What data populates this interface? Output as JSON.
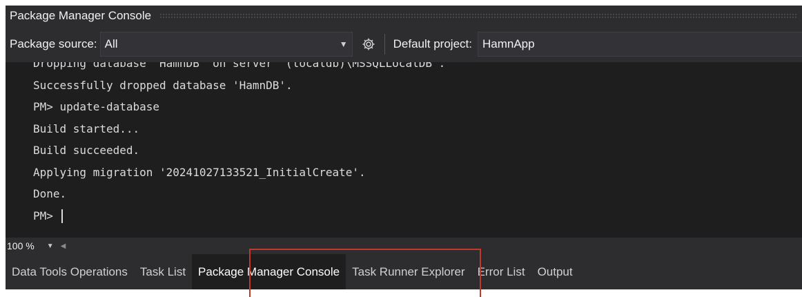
{
  "window": {
    "title": "Package Manager Console"
  },
  "toolbar": {
    "package_source_label": "Package source:",
    "package_source_value": "All",
    "default_project_label": "Default project:",
    "default_project_value": "HamnApp"
  },
  "console": {
    "lines": [
      "Dropping database 'HamnDB' on server '(localdb)\\MSSQLLocalDB'.",
      "Successfully dropped database 'HamnDB'.",
      "PM> update-database",
      "Build started...",
      "Build succeeded.",
      "Applying migration '20241027133521_InitialCreate'.",
      "Done.",
      "PM> "
    ]
  },
  "zoom": {
    "value": "100 %"
  },
  "tabs": [
    {
      "label": "Data Tools Operations"
    },
    {
      "label": "Task List"
    },
    {
      "label": "Package Manager Console"
    },
    {
      "label": "Task Runner Explorer"
    },
    {
      "label": "Error List"
    },
    {
      "label": "Output"
    }
  ],
  "colors": {
    "chrome": "#2d2d30",
    "console_bg": "#1e1e1e",
    "highlight": "#c0392b"
  }
}
